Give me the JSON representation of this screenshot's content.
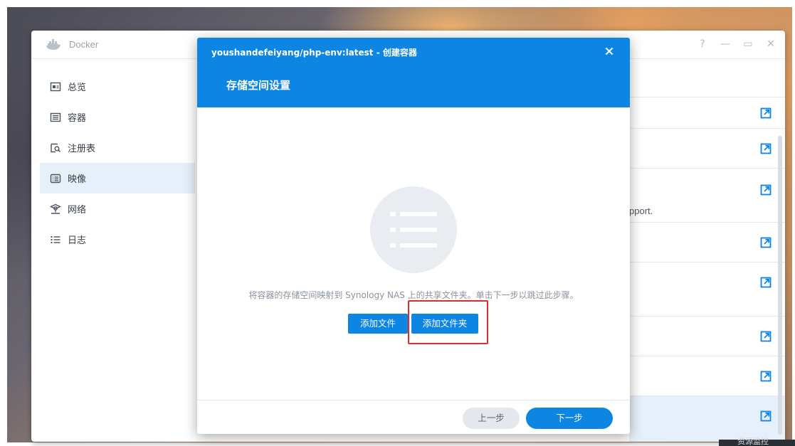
{
  "app": {
    "title": "Docker",
    "window_controls": [
      "?",
      "—",
      "▭",
      "✕"
    ]
  },
  "sidebar": {
    "items": [
      {
        "label": "总览",
        "icon": "overview-icon",
        "active": false
      },
      {
        "label": "容器",
        "icon": "container-icon",
        "active": false
      },
      {
        "label": "注册表",
        "icon": "registry-icon",
        "active": false
      },
      {
        "label": "映像",
        "icon": "image-icon",
        "active": true
      },
      {
        "label": "网络",
        "icon": "network-icon",
        "active": false
      },
      {
        "label": "日志",
        "icon": "log-icon",
        "active": false
      }
    ]
  },
  "background_list": {
    "visible_text_fragment": "pport.",
    "row_icon": "open-external-icon"
  },
  "dialog": {
    "title": "youshandefeiyang/php-env:latest - 创建容器",
    "close_icon": "close-icon",
    "subtitle": "存储空间设置",
    "empty_icon": "list-icon",
    "hint": "将容器的存储空间映射到 Synology NAS 上的共享文件夹。单击下一步以跳过此步骤。",
    "buttons": {
      "add_file": "添加文件",
      "add_folder": "添加文件夹"
    },
    "footer": {
      "prev": "上一步",
      "next": "下一步"
    }
  },
  "taskbar": {
    "partial_text": "资源监控"
  },
  "colors": {
    "primary": "#0d86e3",
    "sidebar_active": "#e6f0fb",
    "highlight_box": "#e02b2b"
  }
}
